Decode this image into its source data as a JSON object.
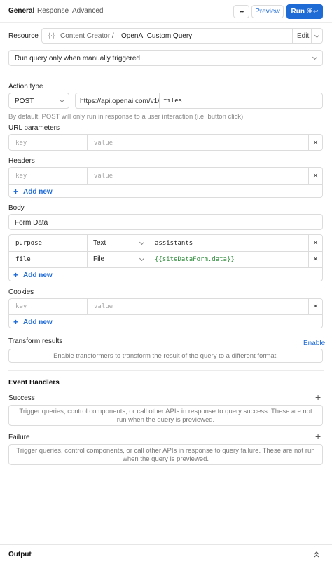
{
  "tabs": {
    "general": "General",
    "response": "Response",
    "advanced": "Advanced"
  },
  "toolbar": {
    "more_label": "•••",
    "preview_label": "Preview",
    "run_label": "Run",
    "run_shortcut": "⌘↩"
  },
  "resource": {
    "label": "Resource",
    "prefix": "Content Creator /",
    "name": "OpenAI Custom Query",
    "edit_label": "Edit"
  },
  "trigger": {
    "value": "Run query only when manually triggered"
  },
  "action": {
    "label": "Action type",
    "method": "POST",
    "base_url": "https://api.openai.com/v1/",
    "path": "files",
    "hint": "By default, POST will only run in response to a user interaction (i.e. button click)."
  },
  "url_params": {
    "label": "URL parameters",
    "key_placeholder": "key",
    "value_placeholder": "value"
  },
  "headers": {
    "label": "Headers",
    "key_placeholder": "key",
    "value_placeholder": "value",
    "add_label": "Add new"
  },
  "body": {
    "label": "Body",
    "type": "Form Data",
    "rows": [
      {
        "key": "purpose",
        "type": "Text",
        "value": "assistants"
      },
      {
        "key": "file",
        "type": "File",
        "value": "{{siteDataForm.data}}"
      }
    ],
    "add_label": "Add new"
  },
  "cookies": {
    "label": "Cookies",
    "key_placeholder": "key",
    "value_placeholder": "value",
    "add_label": "Add new"
  },
  "transform": {
    "label": "Transform results",
    "enable_label": "Enable",
    "description": "Enable transformers to transform the result of the query to a different format."
  },
  "event_handlers": {
    "title": "Event Handlers",
    "success_label": "Success",
    "success_text": "Trigger queries, control components, or call other APIs in response to query success. These are not run when the query is previewed.",
    "failure_label": "Failure",
    "failure_text": "Trigger queries, control components, or call other APIs in response to query failure. These are not run when the query is previewed."
  },
  "output": {
    "label": "Output"
  },
  "colors": {
    "accent": "#1f6bd6",
    "border": "#dcdcdc",
    "template_green": "#2e8b3a"
  }
}
